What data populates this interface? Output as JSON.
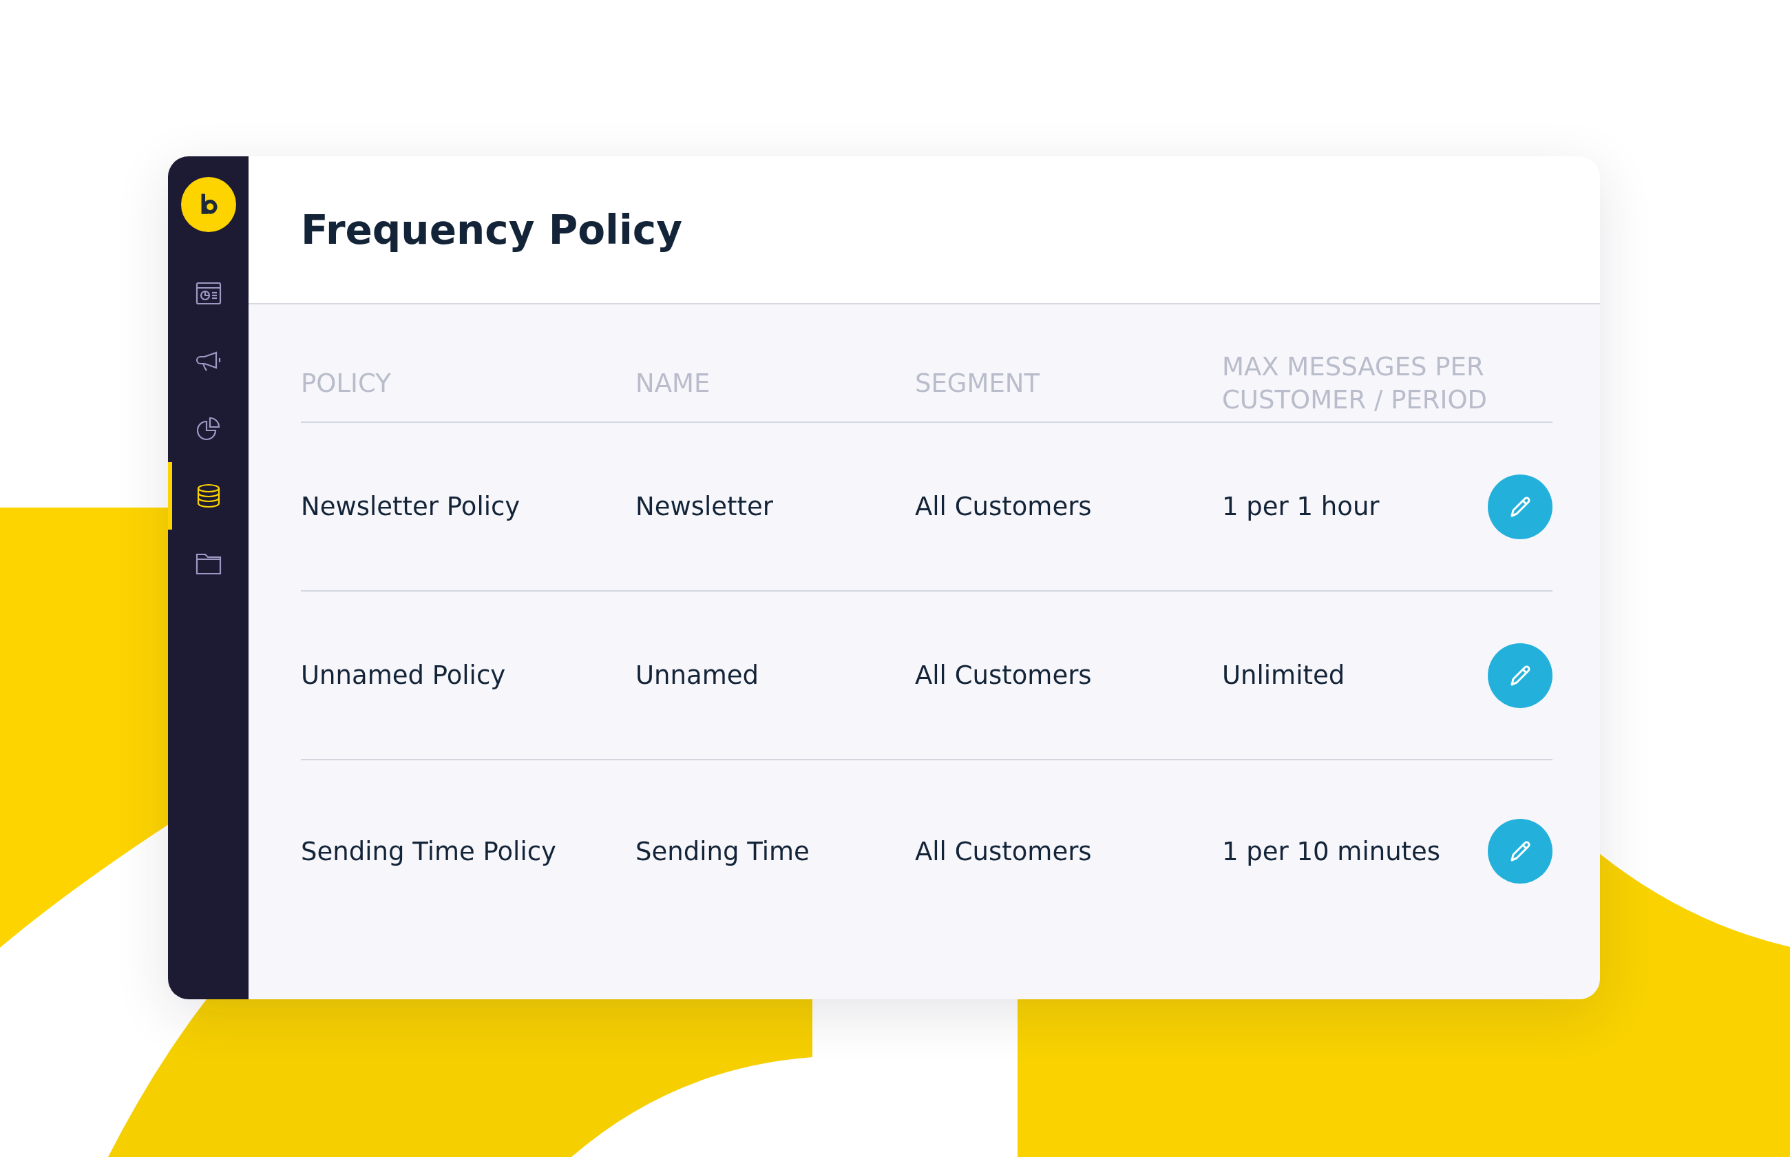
{
  "sidebar": {
    "items": [
      {
        "kind": "dashboard",
        "selected": false
      },
      {
        "kind": "megaphone",
        "selected": false
      },
      {
        "kind": "pie",
        "selected": false
      },
      {
        "kind": "database",
        "selected": true
      },
      {
        "kind": "folder",
        "selected": false
      }
    ]
  },
  "page": {
    "title": "Frequency Policy"
  },
  "table": {
    "columns": [
      "POLICY",
      "NAME",
      "SEGMENT",
      "MAX MESSAGES PER CUSTOMER / PERIOD"
    ],
    "rows": [
      {
        "policy": "Newsletter Policy",
        "name": "Newsletter",
        "segment": "All Customers",
        "max": "1 per 1 hour"
      },
      {
        "policy": "Unnamed Policy",
        "name": "Unnamed",
        "segment": "All Customers",
        "max": "Unlimited"
      },
      {
        "policy": "Sending Time Policy",
        "name": "Sending Time",
        "segment": "All Customers",
        "max": "1 per 10 minutes"
      }
    ]
  }
}
